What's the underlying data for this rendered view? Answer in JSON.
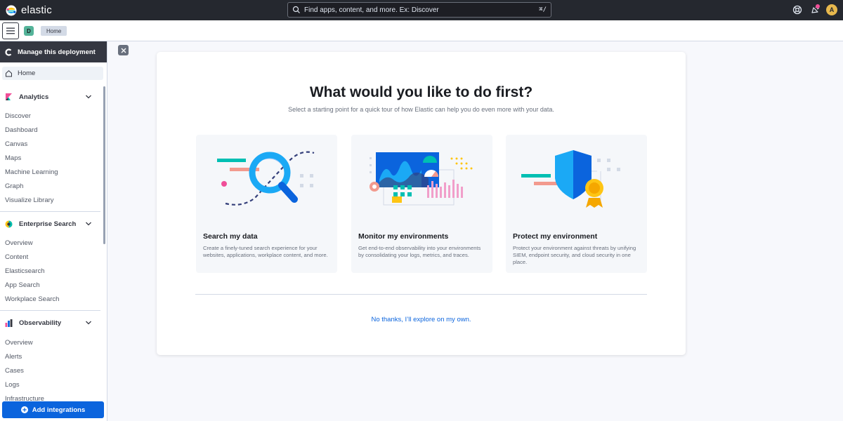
{
  "app": {
    "name": "elastic"
  },
  "search": {
    "placeholder": "Find apps, content, and more. Ex: Discover",
    "shortcut": "⌘/"
  },
  "user": {
    "initial": "A"
  },
  "space": {
    "initial": "D"
  },
  "breadcrumb": {
    "current": "Home"
  },
  "sidenav": {
    "deployment_label": "Manage this deployment",
    "home_label": "Home",
    "groups": [
      {
        "title": "Analytics",
        "icon": "kibana-logo-icon",
        "items": [
          "Discover",
          "Dashboard",
          "Canvas",
          "Maps",
          "Machine Learning",
          "Graph",
          "Visualize Library"
        ]
      },
      {
        "title": "Enterprise Search",
        "icon": "enterprise-search-logo-icon",
        "items": [
          "Overview",
          "Content",
          "Elasticsearch",
          "App Search",
          "Workplace Search"
        ]
      },
      {
        "title": "Observability",
        "icon": "observability-logo-icon",
        "items": [
          "Overview",
          "Alerts",
          "Cases",
          "Logs",
          "Infrastructure"
        ]
      }
    ],
    "add_integrations_label": "Add integrations"
  },
  "main": {
    "title": "What would you like to do first?",
    "subtitle": "Select a starting point for a quick tour of how Elastic can help you do even more with your data.",
    "cards": [
      {
        "title": "Search my data",
        "description": "Create a finely-tuned search experience for your websites, applications, workplace content, and more."
      },
      {
        "title": "Monitor my environments",
        "description": "Get end-to-end observability into your environments by consolidating your logs, metrics, and traces."
      },
      {
        "title": "Protect my environment",
        "description": "Protect your environment against threats by unifying SIEM, endpoint security, and cloud security in one place."
      }
    ],
    "skip_link": "No thanks, I’ll explore on my own."
  },
  "colors": {
    "header": "#25282f",
    "accent": "#0b64dd",
    "teal": "#00bfb3",
    "pink": "#f04e98",
    "salmon": "#f29a8e",
    "gold": "#fec514"
  }
}
